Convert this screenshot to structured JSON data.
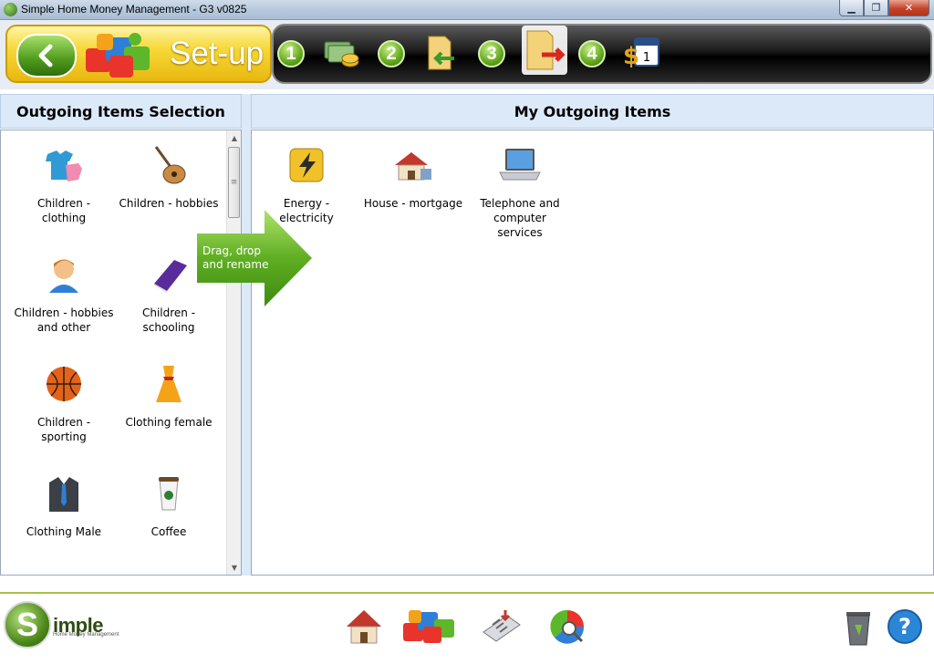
{
  "window": {
    "title": "Simple Home Money Management - G3 v0825",
    "controls": {
      "minimize": "▁",
      "maximize": "❐",
      "close": "✕"
    }
  },
  "banner": {
    "back_icon": "back-arrow-icon",
    "setup_label": "Set-up",
    "steps": [
      "1",
      "2",
      "3",
      "4"
    ]
  },
  "left_panel": {
    "title": "Outgoing Items Selection",
    "items": [
      {
        "label": "Children - clothing",
        "icon": "baby-clothes-icon"
      },
      {
        "label": "Children - hobbies",
        "icon": "guitar-icon"
      },
      {
        "label": "Children - hobbies and other",
        "icon": "child-avatar-icon"
      },
      {
        "label": "Children - schooling",
        "icon": "book-icon"
      },
      {
        "label": "Children - sporting",
        "icon": "basketball-icon"
      },
      {
        "label": "Clothing female",
        "icon": "dress-icon"
      },
      {
        "label": "Clothing Male",
        "icon": "suit-icon"
      },
      {
        "label": "Coffee",
        "icon": "coffee-cup-icon"
      }
    ]
  },
  "drag_hint": {
    "line1": "Drag, drop",
    "line2": "and rename"
  },
  "right_panel": {
    "title": "My Outgoing Items",
    "items": [
      {
        "label": "Energy - electricity",
        "icon": "lightning-icon"
      },
      {
        "label": "House - mortgage",
        "icon": "house-icon"
      },
      {
        "label": "Telephone and computer services",
        "icon": "laptop-icon"
      }
    ]
  },
  "footer": {
    "logo_letter": "S",
    "logo_word": "imple",
    "logo_sub": "Home Money Management",
    "icons": [
      "home-icon",
      "puzzle-setup-icon",
      "calculator-icon",
      "chart-search-icon",
      "recycle-bin-icon",
      "help-icon"
    ],
    "help_label": "?"
  }
}
